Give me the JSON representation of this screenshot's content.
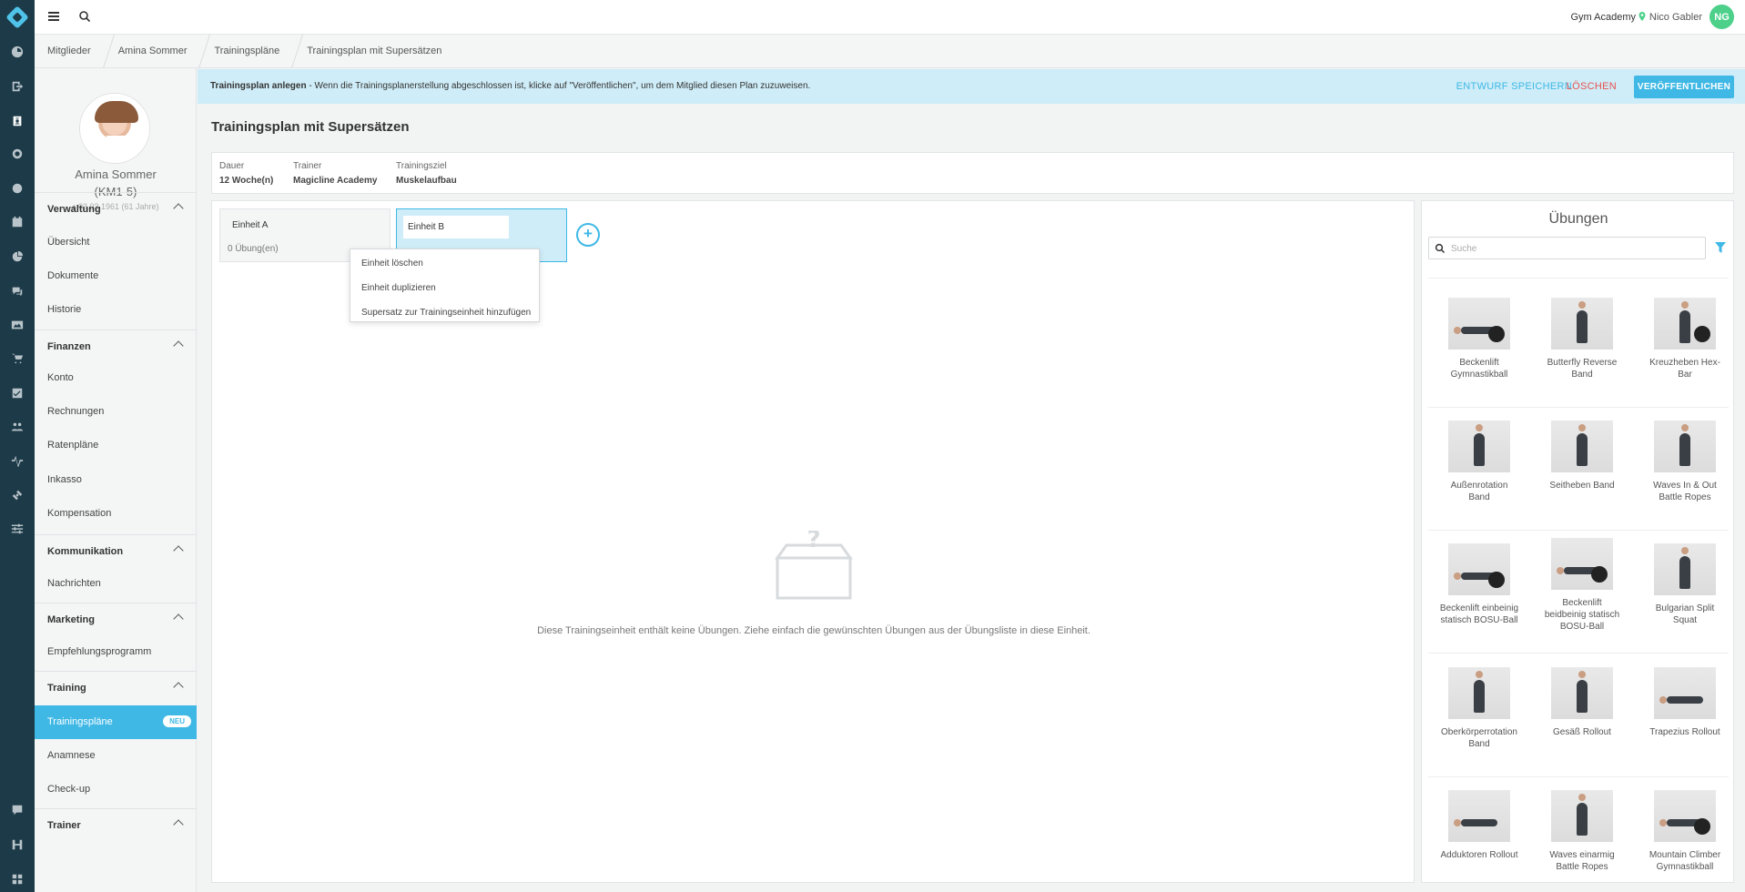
{
  "app": {
    "gym": "Gym Academy",
    "user_name": "Nico Gabler",
    "user_initials": "NG"
  },
  "breadcrumb": [
    "Mitglieder",
    "Amina Sommer",
    "Trainingspläne",
    "Trainingsplan mit Supersätzen"
  ],
  "member": {
    "name": "Amina Sommer",
    "id": "(KM1-5)",
    "birth": "03.03.1961 (61 Jahre)"
  },
  "sidebar": {
    "sections": [
      {
        "title": "Verwaltung",
        "items": [
          "Übersicht",
          "Dokumente",
          "Historie"
        ]
      },
      {
        "title": "Finanzen",
        "items": [
          "Konto",
          "Rechnungen",
          "Ratenpläne",
          "Inkasso",
          "Kompensation"
        ]
      },
      {
        "title": "Kommunikation",
        "items": [
          "Nachrichten"
        ]
      },
      {
        "title": "Marketing",
        "items": [
          "Empfehlungsprogramm"
        ]
      },
      {
        "title": "Training",
        "items": [
          "Trainingspläne",
          "Anamnese",
          "Check-up"
        ]
      },
      {
        "title": "Trainer",
        "items": []
      }
    ],
    "active_item": "Trainingspläne",
    "badge": "NEU"
  },
  "banner": {
    "title": "Trainingsplan anlegen",
    "message": " -  Wenn die Trainingsplanerstellung abgeschlossen ist, klicke auf \"Veröffentlichen\", um dem Mitglied diesen Plan zuzuweisen.",
    "save_draft": "ENTWURF SPEICHERN",
    "delete": "LÖSCHEN",
    "publish": "VERÖFFENTLICHEN"
  },
  "plan": {
    "title": "Trainingsplan mit Supersätzen",
    "meta": [
      {
        "label": "Dauer",
        "value": "12 Woche(n)"
      },
      {
        "label": "Trainer",
        "value": "Magicline Academy"
      },
      {
        "label": "Trainingsziel",
        "value": "Muskelaufbau"
      }
    ]
  },
  "units": {
    "a_name": "Einheit A",
    "a_count": "0 Übung(en)",
    "b_name": "Einheit B"
  },
  "context_menu": [
    "Einheit löschen",
    "Einheit duplizieren",
    "Supersatz zur Trainingseinheit hinzufügen"
  ],
  "empty_message": "Diese Trainingseinheit enthält keine Übungen. Ziehe einfach die gewünschten Übungen aus der Übungsliste in diese Einheit.",
  "exercises": {
    "title": "Übungen",
    "search_placeholder": "Suche",
    "items": [
      {
        "label": "Beckenlift Gymnastikball",
        "lines": [
          "Beckenlift",
          "Gymnastikball"
        ]
      },
      {
        "label": "Butterfly Reverse Band",
        "lines": [
          "Butterfly Reverse",
          "Band"
        ]
      },
      {
        "label": "Kreuzheben Hex-Bar",
        "lines": [
          "Kreuzheben Hex-",
          "Bar"
        ]
      },
      {
        "label": "Außenrotation Band",
        "lines": [
          "Außenrotation",
          "Band"
        ]
      },
      {
        "label": "Seitheben Band",
        "lines": [
          "Seitheben Band"
        ]
      },
      {
        "label": "Waves In & Out Battle Ropes",
        "lines": [
          "Waves In & Out",
          "Battle Ropes"
        ]
      },
      {
        "label": "Beckenlift einbeinig statisch BOSU-Ball",
        "lines": [
          "Beckenlift einbeinig",
          "statisch BOSU-Ball"
        ]
      },
      {
        "label": "Beckenlift beidbeinig statisch BOSU-Ball",
        "lines": [
          "Beckenlift",
          "beidbeinig statisch",
          "BOSU-Ball"
        ]
      },
      {
        "label": "Bulgarian Split Squat",
        "lines": [
          "Bulgarian Split",
          "Squat"
        ]
      },
      {
        "label": "Oberkörperrotation Band",
        "lines": [
          "Oberkörperrotation",
          "Band"
        ]
      },
      {
        "label": "Gesäß Rollout",
        "lines": [
          "Gesäß Rollout"
        ]
      },
      {
        "label": "Trapezius Rollout",
        "lines": [
          "Trapezius Rollout"
        ]
      },
      {
        "label": "Adduktoren Rollout",
        "lines": [
          "Adduktoren Rollout"
        ]
      },
      {
        "label": "Waves einarmig Battle Ropes",
        "lines": [
          "Waves einarmig",
          "Battle Ropes"
        ]
      },
      {
        "label": "Mountain Climber Gymnastikball",
        "lines": [
          "Mountain Climber",
          "Gymnastikball"
        ]
      }
    ]
  },
  "colors": {
    "accent": "#3fb8e5",
    "rail": "#1d3a48",
    "danger": "#e8524f",
    "banner": "#cfedf8",
    "avatar": "#4cd08a"
  }
}
